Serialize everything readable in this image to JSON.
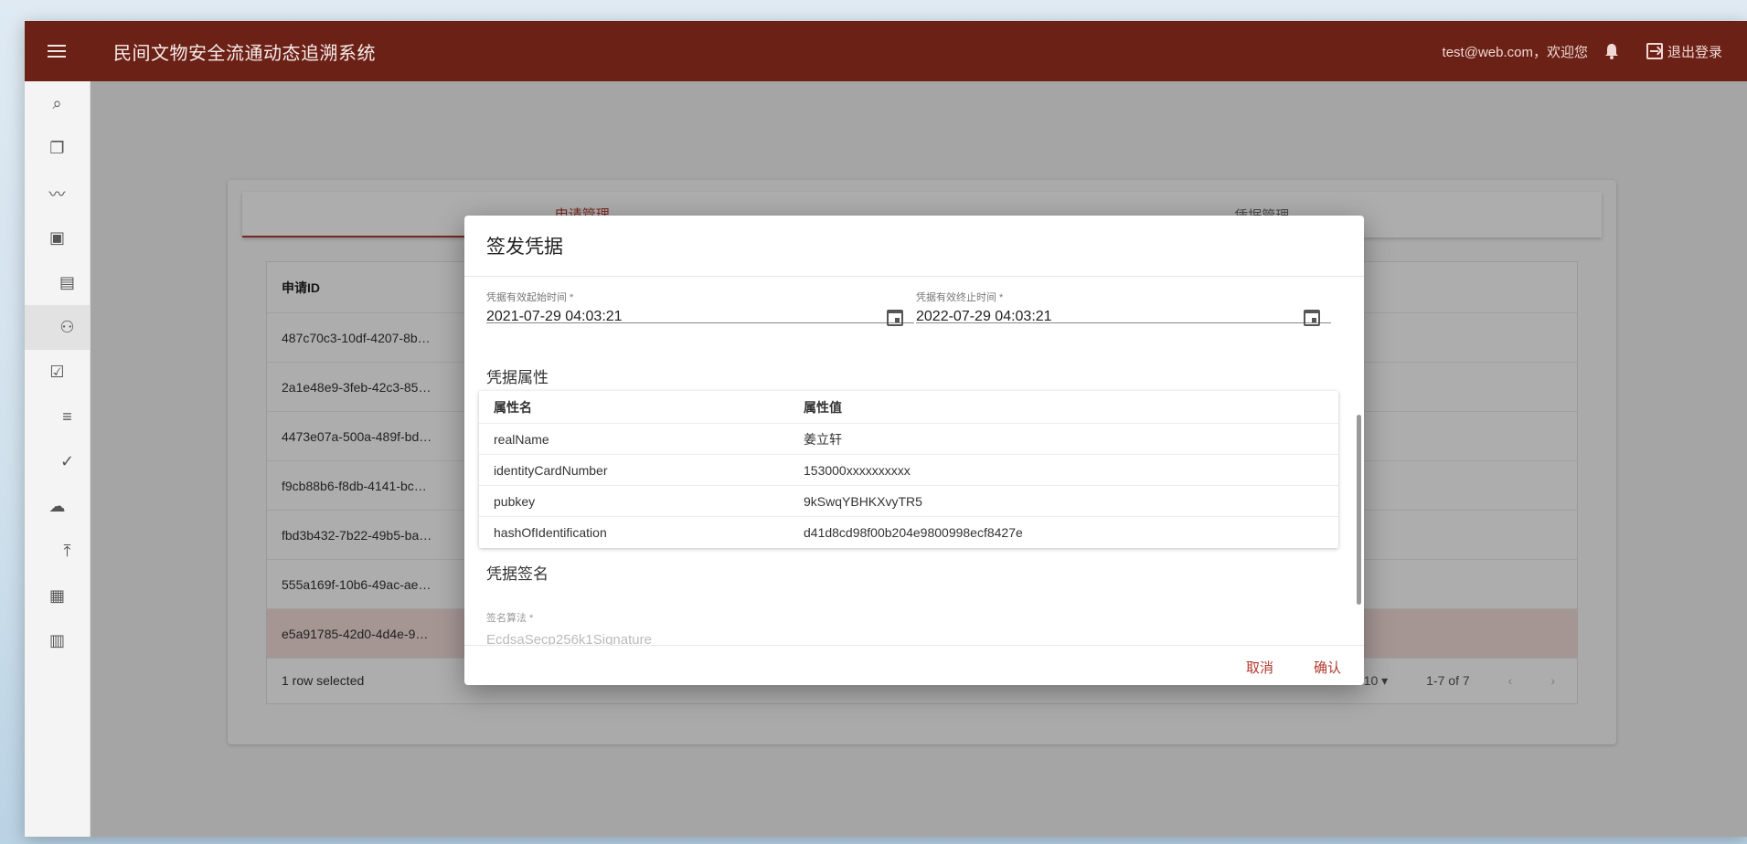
{
  "app": {
    "title": "民间文物安全流通动态追溯系统",
    "user_greeting": "test@web.com，欢迎您",
    "logout_label": "退出登录"
  },
  "sidebar": {
    "items": [
      {
        "icon": "search-icon",
        "glyph": "⌕"
      },
      {
        "icon": "library-icon",
        "glyph": "❐"
      },
      {
        "icon": "trend-icon",
        "glyph": "〰"
      },
      {
        "icon": "wallet-icon",
        "glyph": "▣"
      },
      {
        "icon": "document-icon",
        "glyph": "▤"
      },
      {
        "icon": "group-icon",
        "glyph": "⚇"
      },
      {
        "icon": "clipboard-check-icon",
        "glyph": "☑"
      },
      {
        "icon": "playlist-check-icon",
        "glyph": "≡"
      },
      {
        "icon": "person-check-icon",
        "glyph": "✓"
      },
      {
        "icon": "cloud-upload-icon",
        "glyph": "☁"
      },
      {
        "icon": "merge-icon",
        "glyph": "⤒"
      },
      {
        "icon": "grid-icon",
        "glyph": "▦"
      },
      {
        "icon": "bar-chart-icon",
        "glyph": "▥"
      }
    ]
  },
  "tabs": [
    "申请管理",
    "凭据管理"
  ],
  "table": {
    "header": "申请ID",
    "rows": [
      "487c70c3-10df-4207-8b…",
      "2a1e48e9-3feb-42c3-85…",
      "4473e07a-500a-489f-bd…",
      "f9cb88b6-f8db-4141-bc…",
      "fbd3b432-7b22-49b5-ba…",
      "555a169f-10b6-49ac-ae…",
      "e5a91785-42d0-4d4e-9…"
    ],
    "footer_selected": "1 row selected",
    "rows_per_page": "10 ▾",
    "range": "1-7 of 7"
  },
  "dialog": {
    "title": "签发凭据",
    "start_label": "凭据有效起始时间 *",
    "start_value": "2021-07-29 04:03:21",
    "end_label": "凭据有效终止时间 *",
    "end_value": "2022-07-29 04:03:21",
    "attributes_title": "凭据属性",
    "attr_headers": [
      "属性名",
      "属性值"
    ],
    "attributes": [
      {
        "name": "realName",
        "value": "姜立轩"
      },
      {
        "name": "identityCardNumber",
        "value": "153000xxxxxxxxxx"
      },
      {
        "name": "pubkey",
        "value": "9kSwqYBHKXvyTR5"
      },
      {
        "name": "hashOfIdentification",
        "value": "d41d8cd98f00b204e9800998ecf8427e"
      }
    ],
    "signature_title": "凭据签名",
    "sig_algo_label": "签名算法 *",
    "sig_algo_value": "EcdsaSecp256k1Signature",
    "cancel_label": "取消",
    "confirm_label": "确认"
  },
  "colors": {
    "appbar": "#6c2117",
    "accent": "#b03a2e",
    "selected_row": "#f3dedb"
  }
}
